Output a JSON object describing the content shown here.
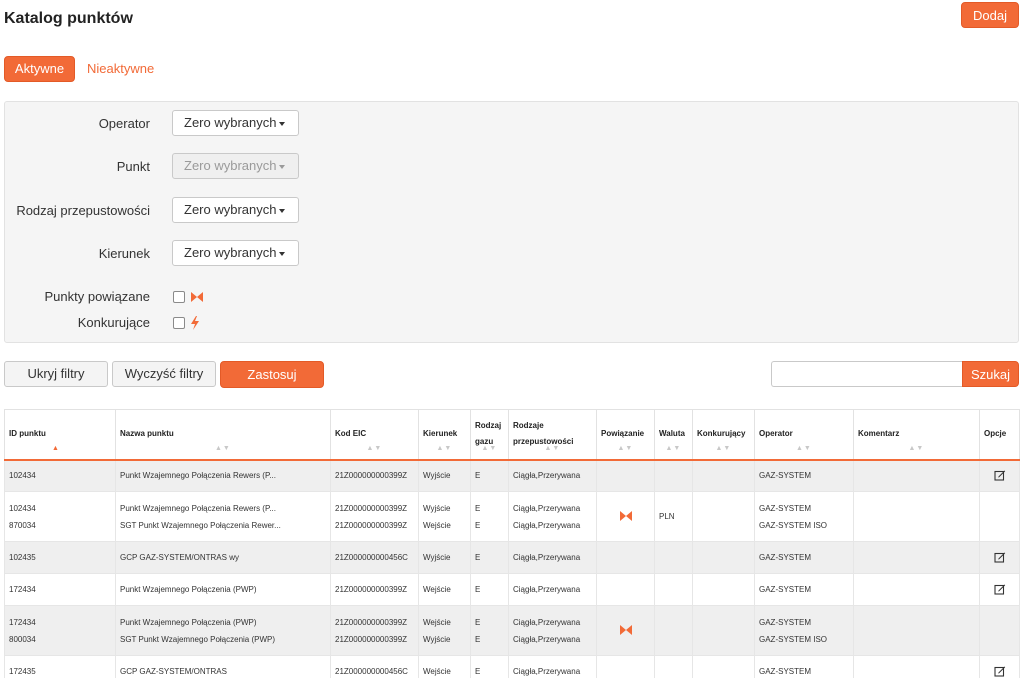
{
  "header": {
    "title": "Katalog punktów",
    "add_label": "Dodaj"
  },
  "tabs": [
    {
      "label": "Aktywne",
      "active": true
    },
    {
      "label": "Nieaktywne",
      "active": false
    }
  ],
  "filters": {
    "operator_label": "Operator",
    "operator_value": "Zero wybranych",
    "point_label": "Punkt",
    "point_value": "Zero wybranych",
    "capacity_label": "Rodzaj przepustowości",
    "capacity_value": "Zero wybranych",
    "direction_label": "Kierunek",
    "direction_value": "Zero wybranych",
    "linked_label": "Punkty powiązane",
    "competing_label": "Konkurujące"
  },
  "actions": {
    "hide_filters": "Ukryj filtry",
    "clear_filters": "Wyczyść filtry",
    "apply": "Zastosuj",
    "search_placeholder": "",
    "search_label": "Szukaj"
  },
  "colors": {
    "accent": "#f26a37",
    "row_alt": "#efefef"
  },
  "table": {
    "columns": [
      "ID punktu",
      "Nazwa punktu",
      "Kod EIC",
      "Kierunek",
      "Rodzaj gazu",
      "Rodzaje przepustowości",
      "Powiązanie",
      "Waluta",
      "Konkurujący",
      "Operator",
      "Komentarz",
      "Opcje"
    ],
    "rows": [
      {
        "ids": [
          "102434"
        ],
        "names": [
          "Punkt Wzajemnego Połączenia Rewers (P..."
        ],
        "eics": [
          "21Z000000000399Z"
        ],
        "directions": [
          "Wyjście"
        ],
        "gas": [
          "E"
        ],
        "capacity": [
          "Ciągła,Przerywana"
        ],
        "linked": false,
        "currency": "",
        "operators": [
          "GAZ-SYSTEM"
        ],
        "editable": true
      },
      {
        "ids": [
          "102434",
          "870034"
        ],
        "names": [
          "Punkt Wzajemnego Połączenia Rewers (P...",
          "SGT Punkt Wzajemnego Połączenia Rewer..."
        ],
        "eics": [
          "21Z000000000399Z",
          "21Z000000000399Z"
        ],
        "directions": [
          "Wyjście",
          "Wejście"
        ],
        "gas": [
          "E",
          "E"
        ],
        "capacity": [
          "Ciągła,Przerywana",
          "Ciągła,Przerywana"
        ],
        "linked": true,
        "currency": "PLN",
        "operators": [
          "GAZ-SYSTEM",
          "GAZ-SYSTEM ISO"
        ],
        "editable": false
      },
      {
        "ids": [
          "102435"
        ],
        "names": [
          "GCP GAZ-SYSTEM/ONTRAS wy"
        ],
        "eics": [
          "21Z000000000456C"
        ],
        "directions": [
          "Wyjście"
        ],
        "gas": [
          "E"
        ],
        "capacity": [
          "Ciągła,Przerywana"
        ],
        "linked": false,
        "currency": "",
        "operators": [
          "GAZ-SYSTEM"
        ],
        "editable": true
      },
      {
        "ids": [
          "172434"
        ],
        "names": [
          "Punkt Wzajemnego Połączenia (PWP)"
        ],
        "eics": [
          "21Z000000000399Z"
        ],
        "directions": [
          "Wejście"
        ],
        "gas": [
          "E"
        ],
        "capacity": [
          "Ciągła,Przerywana"
        ],
        "linked": false,
        "currency": "",
        "operators": [
          "GAZ-SYSTEM"
        ],
        "editable": true
      },
      {
        "ids": [
          "172434",
          "800034"
        ],
        "names": [
          "Punkt Wzajemnego Połączenia (PWP)",
          "SGT Punkt Wzajemnego Połączenia (PWP)"
        ],
        "eics": [
          "21Z000000000399Z",
          "21Z000000000399Z"
        ],
        "directions": [
          "Wejście",
          "Wyjście"
        ],
        "gas": [
          "E",
          "E"
        ],
        "capacity": [
          "Ciągła,Przerywana",
          "Ciągła,Przerywana"
        ],
        "linked": true,
        "currency": "",
        "operators": [
          "GAZ-SYSTEM",
          "GAZ-SYSTEM ISO"
        ],
        "editable": false
      },
      {
        "ids": [
          "172435"
        ],
        "names": [
          "GCP GAZ-SYSTEM/ONTRAS"
        ],
        "eics": [
          "21Z000000000456C"
        ],
        "directions": [
          "Wejście"
        ],
        "gas": [
          "E"
        ],
        "capacity": [
          "Ciągła,Przerywana"
        ],
        "linked": false,
        "currency": "",
        "operators": [
          "GAZ-SYSTEM"
        ],
        "editable": true
      }
    ]
  }
}
